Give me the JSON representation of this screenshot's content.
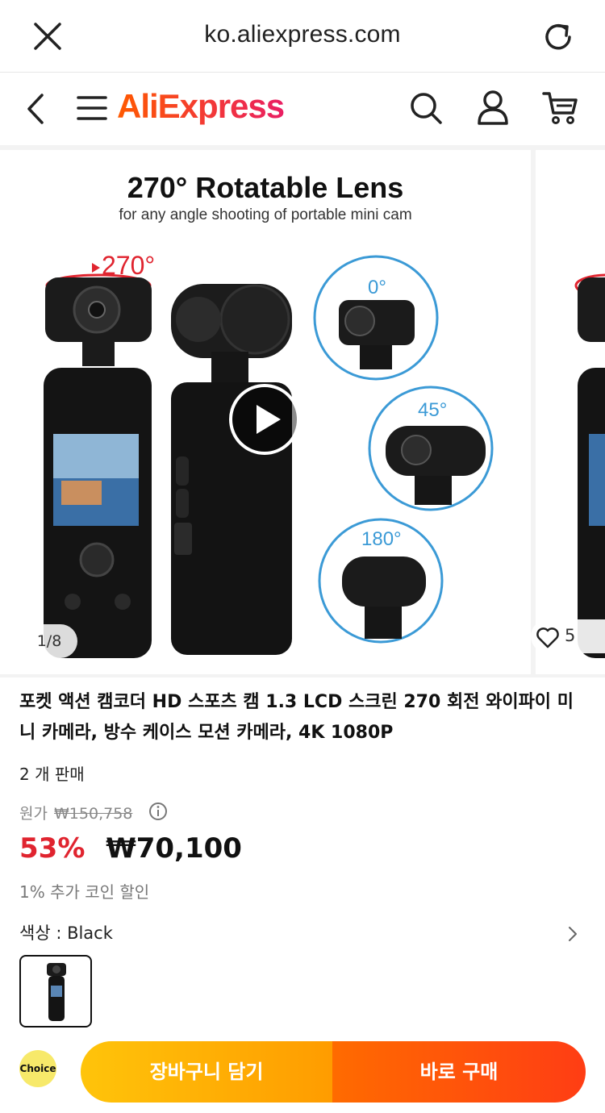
{
  "browser": {
    "url": "ko.aliexpress.com"
  },
  "header": {
    "logo_text": "AliExpress"
  },
  "gallery": {
    "image_title": "270° Rotatable Lens",
    "image_subtitle": "for any angle shooting of portable mini cam",
    "angle_labels": [
      "270°",
      "0°",
      "45°",
      "180°"
    ],
    "counter": "1/8",
    "favorites_count": "5"
  },
  "product": {
    "title": "포켓 액션 캠코더 HD 스포츠 캠 1.3 LCD 스크린 270 회전 와이파이 미니 카메라, 방수 케이스 모션 카메라, 4K 1080P",
    "sold": "2 개 판매",
    "original_label": "원가",
    "original_price": "₩150,758",
    "discount": "53%",
    "price": "₩70,100",
    "coin_discount": "1% 추가 코인 할인",
    "color_label": "색상 : Black"
  },
  "actions": {
    "choice_badge": "Choice",
    "add_to_cart": "장바구니 담기",
    "buy_now": "바로 구매"
  },
  "colors": {
    "accent_red": "#e0242f",
    "cart_button": "#ffb300",
    "buy_button": "#ff4a10"
  }
}
